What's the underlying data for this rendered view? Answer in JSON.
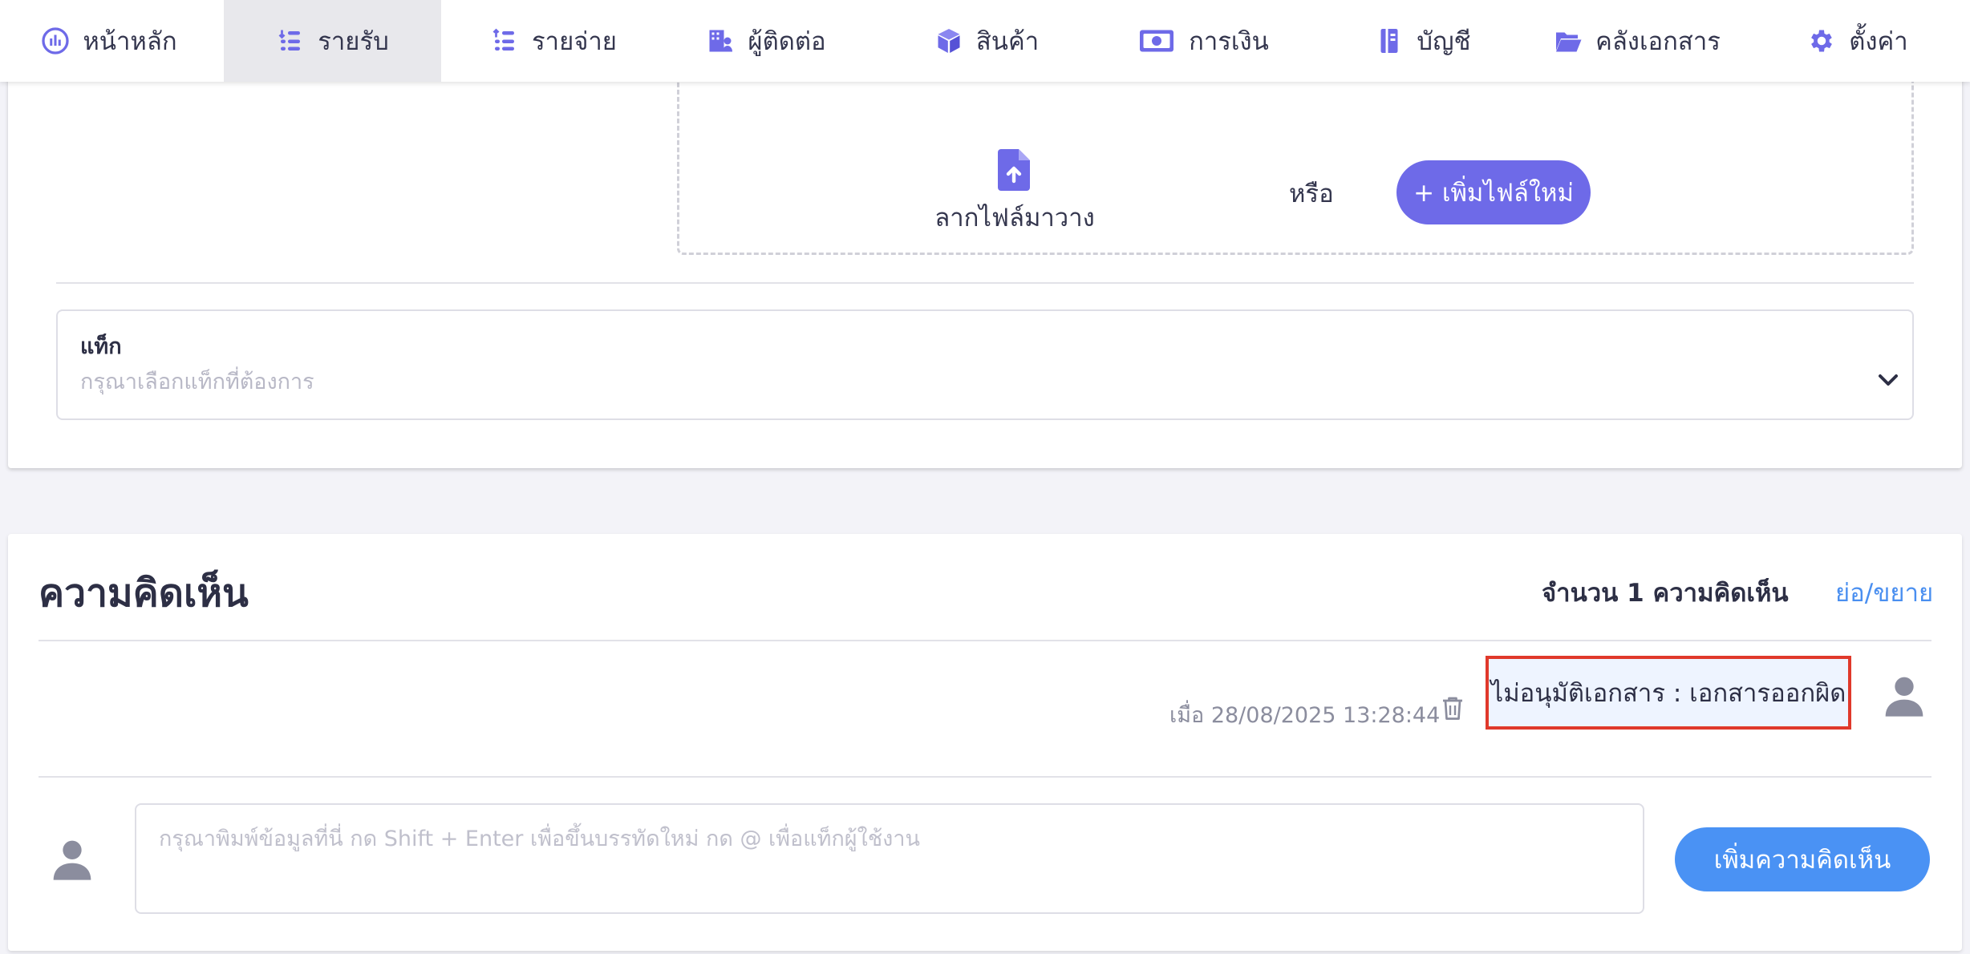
{
  "nav": {
    "items": [
      {
        "label": "หน้าหลัก",
        "icon": "dashboard-icon"
      },
      {
        "label": "รายรับ",
        "icon": "income-icon"
      },
      {
        "label": "รายจ่าย",
        "icon": "expense-icon"
      },
      {
        "label": "ผู้ติดต่อ",
        "icon": "contacts-icon"
      },
      {
        "label": "สินค้า",
        "icon": "box-icon"
      },
      {
        "label": "การเงิน",
        "icon": "money-icon"
      },
      {
        "label": "บัญชี",
        "icon": "ledger-icon"
      },
      {
        "label": "คลังเอกสาร",
        "icon": "folder-icon"
      },
      {
        "label": "ตั้งค่า",
        "icon": "gear-icon"
      }
    ],
    "active_index": 1
  },
  "upload": {
    "drag_text": "ลากไฟล์มาวาง",
    "or_text": "หรือ",
    "add_file_label": "+ เพิ่มไฟล์ใหม่"
  },
  "tags": {
    "label": "แท็ก",
    "placeholder": "กรุณาเลือกแท็กที่ต้องการ"
  },
  "comments": {
    "title": "ความคิดเห็น",
    "count_text": "จำนวน 1 ความคิดเห็น",
    "collapse_label": "ย่อ/ขยาย",
    "items": [
      {
        "text": "ไม่อนุมัติเอกสาร : เอกสารออกผิด",
        "timestamp": "เมื่อ 28/08/2025 13:28:44"
      }
    ],
    "input_placeholder": "กรุณาพิมพ์ข้อมูลที่นี่ กด Shift + Enter เพื่อขึ้นบรรทัดใหม่ กด @ เพื่อแท็กผู้ใช้งาน",
    "input_value": "",
    "submit_label": "เพิ่มความคิดเห็น"
  },
  "colors": {
    "accent": "#6e6ae8",
    "primary_button": "#4a92f4",
    "link": "#4a8ff0",
    "highlight_border": "#e0392b",
    "highlight_bg": "#eef4ff"
  }
}
